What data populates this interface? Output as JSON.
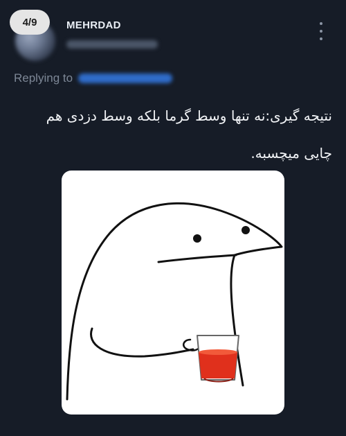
{
  "header": {
    "page_counter": "4/9",
    "username": "MEHRDAD",
    "more_icon": "more-vertical-icon"
  },
  "reply": {
    "label": "Replying to"
  },
  "tweet": {
    "text": "نتیجه گیری:نه تنها وسط گرما بلکه وسط دزدی هم چایی میچسبه."
  },
  "media": {
    "kind": "meme-illustration",
    "icon": "blob-creature-holding-tea-glass-icon"
  },
  "colors": {
    "background": "#161c27",
    "accent_link": "#2f6cc9",
    "tea": "#e0301c"
  }
}
